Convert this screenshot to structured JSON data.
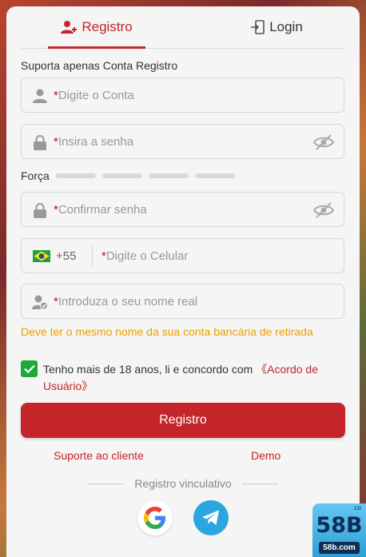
{
  "tabs": {
    "register": "Registro",
    "login": "Login"
  },
  "hint": "Suporta apenas Conta Registro",
  "fields": {
    "required_mark": "*",
    "account": "Digite o Conta",
    "password": "Insira a senha",
    "confirm": "Confirmar senha",
    "phone_code": "+55",
    "phone": "Digite o Celular",
    "real_name": "Introduza o seu nome real"
  },
  "strength_label": "Força",
  "note": "Deve ter o mesmo nome da sua conta bancária de retirada",
  "agreement": {
    "text": "Tenho mais de 18 anos, li e concordo com ",
    "link": "《Acordo de Usuário》",
    "checked": true
  },
  "register_button": "Registro",
  "links": {
    "support": "Suporte ao cliente",
    "demo": "Demo"
  },
  "divider": "Registro vinculativo",
  "social": [
    "google-icon",
    "telegram-icon"
  ],
  "badge": {
    "main": "58B",
    "sub": "58b.com",
    "tag": ".co"
  },
  "colors": {
    "accent": "#c4252a",
    "check": "#1fa93b",
    "warning": "#e8a000"
  }
}
